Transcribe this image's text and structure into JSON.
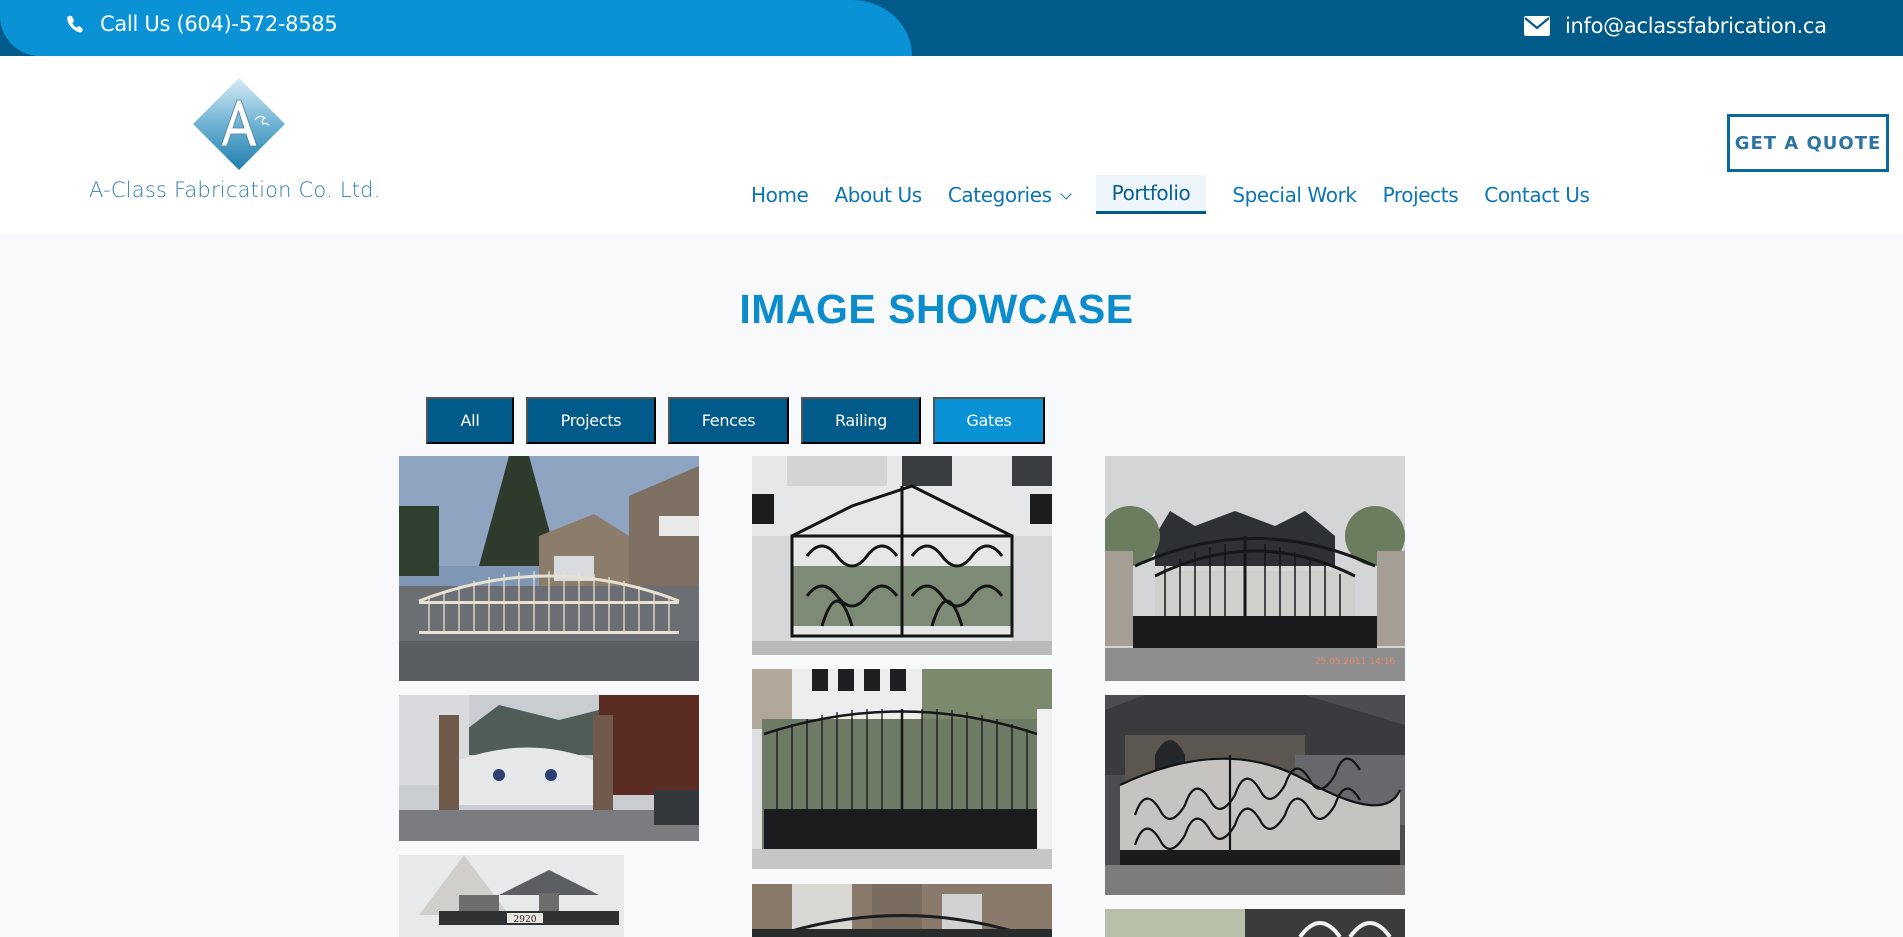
{
  "topbar": {
    "phone_label": "Call Us (604)-572-8585",
    "phone_icon": "phone-icon",
    "email_label": "info@aclassfabrication.ca",
    "email_icon": "envelope-icon"
  },
  "header": {
    "logo_letter": "A",
    "company_name": "A-Class Fabrication Co. Ltd.",
    "nav": [
      {
        "label": "Home",
        "active": false
      },
      {
        "label": "About Us",
        "active": false
      },
      {
        "label": "Categories",
        "active": false,
        "has_dropdown": true
      },
      {
        "label": "Portfolio",
        "active": true
      },
      {
        "label": "Special Work",
        "active": false
      },
      {
        "label": "Projects",
        "active": false
      },
      {
        "label": "Contact Us",
        "active": false
      }
    ],
    "quote_button": "GET A QUOTE"
  },
  "showcase": {
    "title": "IMAGE SHOWCASE",
    "filters": [
      {
        "label": "All",
        "active": false
      },
      {
        "label": "Projects",
        "active": false
      },
      {
        "label": "Fences",
        "active": false
      },
      {
        "label": "Railing",
        "active": false
      },
      {
        "label": "Gates",
        "active": true
      }
    ],
    "images": [
      {
        "description": "White arched sliding gate in front of house",
        "column": 1
      },
      {
        "description": "White ornamental gate at temple with mountains",
        "column": 1
      },
      {
        "description": "House entrance with 2920 address sign",
        "column": 1,
        "address_sign": "2920"
      },
      {
        "description": "Black ornate wrought iron double gate",
        "column": 2
      },
      {
        "description": "Black arched gate with scroll top",
        "column": 2
      },
      {
        "description": "Black arched gate in front of brick house",
        "column": 2
      },
      {
        "description": "Black arched double gate with stone pillars",
        "column": 3,
        "timestamp_overlay": "25.05.2011 14:16"
      },
      {
        "description": "Black scroll sliding gate in front of stone house",
        "column": 3
      },
      {
        "description": "Gate with arched house windows",
        "column": 3
      }
    ]
  },
  "colors": {
    "topbar_dark": "#005a8a",
    "topbar_light": "#0993d6",
    "nav_text": "#0b76b5",
    "title": "#0b8ccc",
    "filter_bg": "#005a8a",
    "filter_active": "#0993d6",
    "page_bg": "#f8f9fa"
  }
}
